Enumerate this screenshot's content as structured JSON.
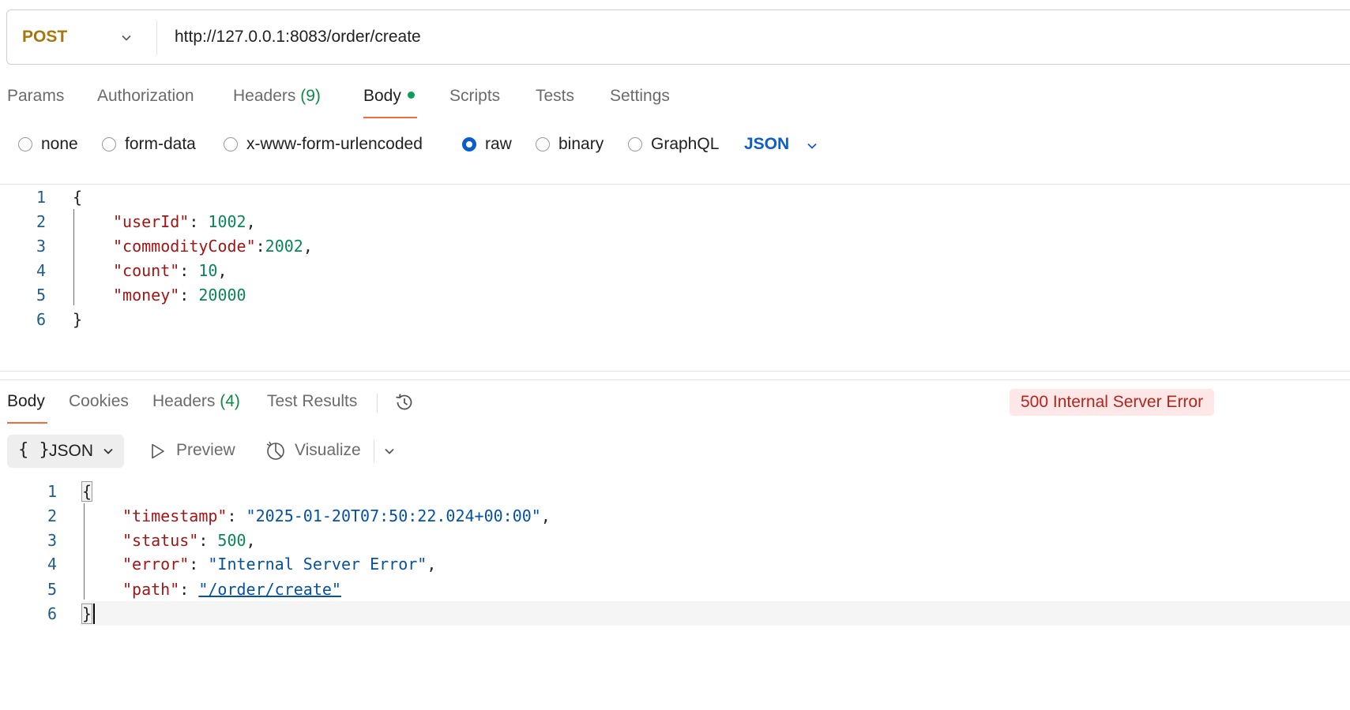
{
  "request": {
    "method": "POST",
    "url": "http://127.0.0.1:8083/order/create",
    "tabs": {
      "params": "Params",
      "authorization": "Authorization",
      "headers": "Headers",
      "headers_count": "(9)",
      "body": "Body",
      "scripts": "Scripts",
      "tests": "Tests",
      "settings": "Settings"
    },
    "body_types": {
      "none": "none",
      "form_data": "form-data",
      "urlencoded": "x-www-form-urlencoded",
      "raw": "raw",
      "binary": "binary",
      "graphql": "GraphQL"
    },
    "selected_body_type": "raw",
    "language": "JSON",
    "code": {
      "line_numbers": [
        "1",
        "2",
        "3",
        "4",
        "5",
        "6"
      ],
      "open": "{",
      "close": "}",
      "lines": [
        {
          "key": "\"userId\"",
          "sep": ": ",
          "value": "1002",
          "trail": ","
        },
        {
          "key": "\"commodityCode\"",
          "sep": ":",
          "value": "2002",
          "trail": ","
        },
        {
          "key": "\"count\"",
          "sep": ": ",
          "value": "10",
          "trail": ","
        },
        {
          "key": "\"money\"",
          "sep": ": ",
          "value": "20000",
          "trail": ""
        }
      ]
    }
  },
  "response": {
    "tabs": {
      "body": "Body",
      "cookies": "Cookies",
      "headers": "Headers",
      "headers_count": "(4)",
      "test_results": "Test Results"
    },
    "status": "500 Internal Server Error",
    "format": "JSON",
    "format_icon": "{ }",
    "preview": "Preview",
    "visualize": "Visualize",
    "code": {
      "line_numbers": [
        "1",
        "2",
        "3",
        "4",
        "5",
        "6"
      ],
      "open": "{",
      "close": "}",
      "lines": [
        {
          "key": "\"timestamp\"",
          "sep": ": ",
          "value": "\"2025-01-20T07:50:22.024+00:00\"",
          "trail": ","
        },
        {
          "key": "\"status\"",
          "sep": ": ",
          "value": "500",
          "trail": ","
        },
        {
          "key": "\"error\"",
          "sep": ": ",
          "value": "\"Internal Server Error\"",
          "trail": ","
        },
        {
          "key": "\"path\"",
          "sep": ": ",
          "value": "\"/order/create\"",
          "trail": ""
        }
      ]
    }
  },
  "colors": {
    "method": "#a8770b",
    "accent_blue": "#0d5ccc",
    "tab_underline": "#f26b3a",
    "error_bg": "#fde7e7",
    "error_text": "#b3261e",
    "json_key": "#a31515",
    "json_number": "#098658",
    "json_string": "#0451a5"
  }
}
